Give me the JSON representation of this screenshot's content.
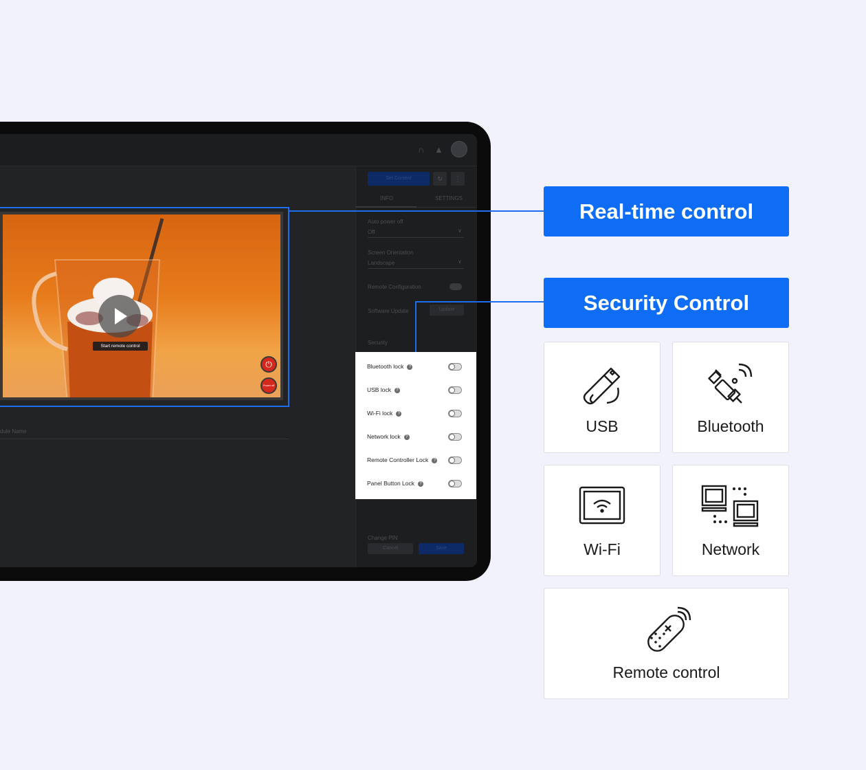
{
  "screen": {
    "topbar_icons": [
      "headset-icon",
      "bell-icon",
      "avatar"
    ],
    "sidebar": {
      "set_content_label": "Set Content",
      "tabs": [
        "INFO",
        "SETTINGS"
      ],
      "auto_power_off_label": "Auto power off",
      "auto_power_off_value": "Off",
      "screen_orientation_label": "Screen Orientation",
      "screen_orientation_value": "Landscape",
      "remote_configuration_label": "Remote Configuration",
      "software_update_label": "Software Update",
      "update_label": "Update",
      "security_label": "Security",
      "change_pin_label": "Change PIN",
      "pin_value": "••••••",
      "cancel_label": "Cancel",
      "save_label": "Save"
    },
    "video": {
      "tooltip": "Start remote control",
      "power_off_label": "Power off"
    },
    "module_name_label": "dule Name",
    "security_popup": [
      {
        "label": "Bluetooth lock",
        "enabled": false
      },
      {
        "label": "USB lock",
        "enabled": false
      },
      {
        "label": "Wi-Fi lock",
        "enabled": false
      },
      {
        "label": "Network lock",
        "enabled": false
      },
      {
        "label": "Remote Controller Lock",
        "enabled": false
      },
      {
        "label": "Panel Button Lock",
        "enabled": false
      }
    ]
  },
  "callouts": {
    "realtime": "Real-time control",
    "security": "Security Control"
  },
  "cards": [
    {
      "label": "USB",
      "icon": "usb-icon"
    },
    {
      "label": "Bluetooth",
      "icon": "bluetooth-icon"
    },
    {
      "label": "Wi-Fi",
      "icon": "wifi-icon"
    },
    {
      "label": "Network",
      "icon": "network-icon"
    },
    {
      "label": "Remote control",
      "icon": "remote-control-icon"
    }
  ],
  "colors": {
    "accent": "#0f6df5",
    "background": "#f1f2fb",
    "device": "#0b0b0c"
  }
}
